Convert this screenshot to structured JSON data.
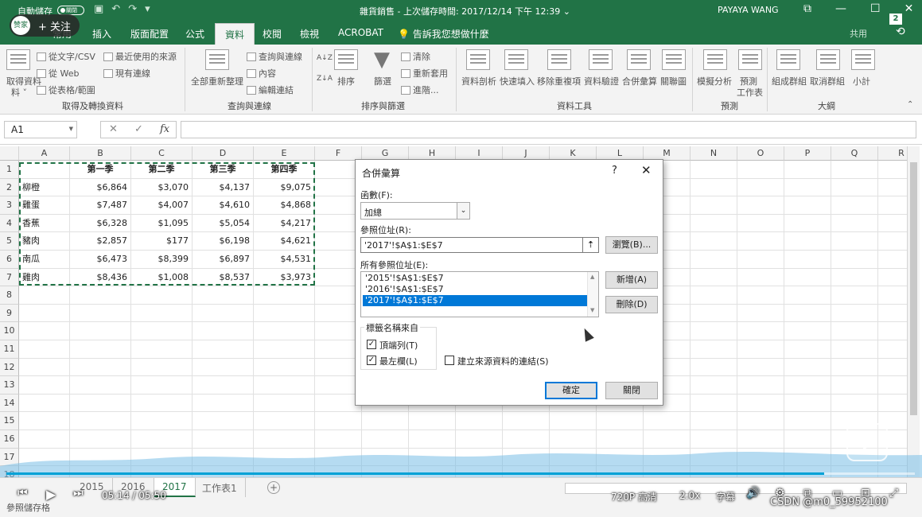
{
  "titlebar": {
    "autosave_label": "自動儲存",
    "autosave_state": "關閉",
    "doc_title": "雜貨銷售 - 上次儲存時間: 2017/12/14 下午 12:39",
    "title_dropdown": "⌄",
    "user": "PAYAYA WANG",
    "restore_icon": "⧉",
    "minimize_icon": "—",
    "maximize_icon": "☐",
    "close_icon": "✕",
    "qat_icons": [
      "save-icon",
      "undo-icon",
      "redo-icon",
      "customize-icon"
    ]
  },
  "follow_overlay": {
    "logo_text": "赞家",
    "label": "+ 关注"
  },
  "ribbon_tabs": {
    "tabs": [
      "常用",
      "插入",
      "版面配置",
      "公式",
      "資料",
      "校閱",
      "檢視",
      "ACROBAT"
    ],
    "active": "資料",
    "tell_me": "告訴我您想做什麼",
    "share": "共用",
    "help_badge": "2"
  },
  "ribbon": {
    "get_transform": {
      "get_data": "取得資料",
      "get_data_more": "料 ˅",
      "from_text": "從文字/CSV",
      "from_web": "從 Web",
      "from_table": "從表格/範圍",
      "recent_sources": "最近使用的來源",
      "existing_connections": "現有連線",
      "group_label": "取得及轉換資料"
    },
    "queries": {
      "refresh_all": "全部重新整理",
      "queries_connections": "查詢與連線",
      "properties": "內容",
      "edit_links": "編輯連結",
      "group_label": "查詢與連線"
    },
    "sort_filter": {
      "az": "A↓Z",
      "za": "Z↓A",
      "sort": "排序",
      "filter": "篩選",
      "clear": "清除",
      "reapply": "重新套用",
      "advanced": "進階...",
      "group_label": "排序與篩選"
    },
    "data_tools": {
      "text_to_columns": "資料剖析",
      "flash_fill": "快速填入",
      "remove_duplicates": "移除重複項",
      "data_validation": "資料驗證",
      "consolidate": "合併彙算",
      "relationships": "關聯圖",
      "group_label": "資料工具"
    },
    "forecast": {
      "what_if": "模擬分析",
      "forecast_sheet": "預測",
      "forecast_sheet2": "工作表",
      "group_label": "預測"
    },
    "outline": {
      "group": "組成群組",
      "ungroup": "取消群組",
      "subtotal": "小計",
      "group_label": "大綱"
    }
  },
  "formula_bar": {
    "name_box": "A1",
    "cancel": "✕",
    "enter": "✓",
    "fx": "fx",
    "formula": ""
  },
  "columns": [
    "A",
    "B",
    "C",
    "D",
    "E",
    "F",
    "G",
    "H",
    "I",
    "J",
    "K",
    "L",
    "M",
    "N",
    "O",
    "P",
    "Q",
    "R"
  ],
  "rows": [
    "1",
    "2",
    "3",
    "4",
    "5",
    "6",
    "7",
    "8",
    "9",
    "10",
    "11",
    "12",
    "13",
    "14",
    "15",
    "16",
    "17",
    "18"
  ],
  "table": {
    "headers": [
      "",
      "第一季",
      "第二季",
      "第三季",
      "第四季"
    ],
    "rows": [
      [
        "柳橙",
        "$6,864",
        "$3,070",
        "$4,137",
        "$9,075"
      ],
      [
        "雞蛋",
        "$7,487",
        "$4,007",
        "$4,610",
        "$4,868"
      ],
      [
        "香蕉",
        "$6,328",
        "$1,095",
        "$5,054",
        "$4,217"
      ],
      [
        "豬肉",
        "$2,857",
        "$177",
        "$6,198",
        "$4,621"
      ],
      [
        "南瓜",
        "$6,473",
        "$8,399",
        "$6,897",
        "$4,531"
      ],
      [
        "雞肉",
        "$8,436",
        "$1,008",
        "$8,537",
        "$3,973"
      ]
    ]
  },
  "dialog": {
    "title": "合併彙算",
    "help": "?",
    "close": "✕",
    "function_label": "函數(F):",
    "function_value": "加總",
    "dropdown_arrow": "⌄",
    "reference_label": "參照位址(R):",
    "reference_value": "'2017'!$A$1:$E$7",
    "collapse_icon": "⇡",
    "all_refs_label": "所有參照位址(E):",
    "all_refs": [
      "'2015'!$A$1:$E$7",
      "'2016'!$A$1:$E$7",
      "'2017'!$A$1:$E$7"
    ],
    "selected_ref_index": 2,
    "scroll_up": "▲",
    "scroll_down": "▼",
    "browse": "瀏覽(B)...",
    "add": "新增(A)",
    "delete": "刪除(D)",
    "labels_group": "標籤名稱來自",
    "top_row": "頂端列(T)",
    "top_row_checked": true,
    "left_column": "最左欄(L)",
    "left_column_checked": true,
    "create_links": "建立來源資料的連結(S)",
    "create_links_checked": false,
    "checkmark": "✓",
    "ok": "確定",
    "close_btn": "關閉"
  },
  "sheets": {
    "tabs": [
      "2015",
      "2016",
      "2017",
      "工作表1"
    ],
    "active": "2017",
    "add": "+"
  },
  "status": {
    "text": "參照儲存格"
  },
  "video": {
    "time": "05:14 / 05:50",
    "progress": 0.9,
    "quality": "720P 高清",
    "speed": "2.0x",
    "subtitle_btn": "字幕",
    "watermark": "CSDN @m0_59952100",
    "prev_icon": "⏮",
    "play_icon": "▶",
    "next_icon": "⏭",
    "volume_icon": "🔊",
    "settings_icon": "⚙",
    "pip_icon": "⧉",
    "fullscreen_icon": "⤢"
  }
}
